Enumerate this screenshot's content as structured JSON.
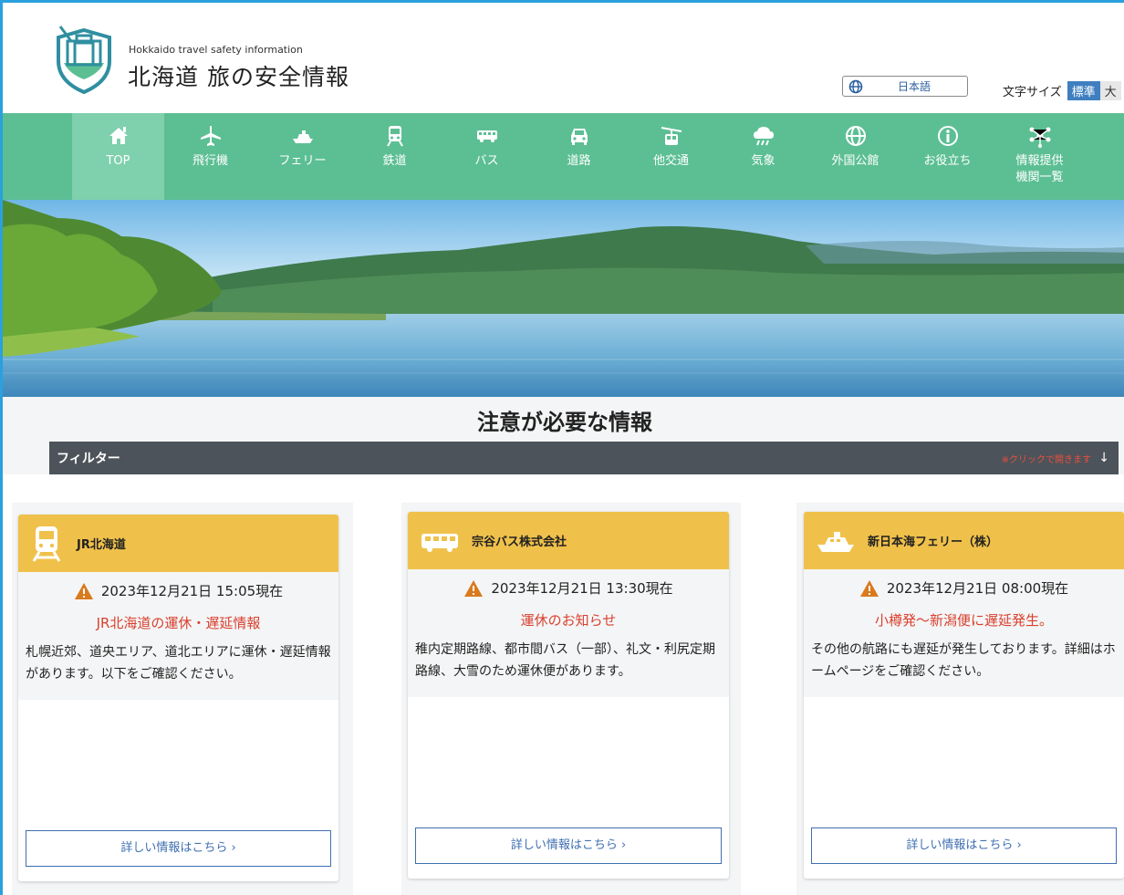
{
  "header": {
    "logo_subtitle": "Hokkaido travel safety information",
    "logo_title": "北海道 旅の安全情報",
    "language": "日本語",
    "font_size_label": "文字サイズ",
    "font_size_standard": "標準",
    "font_size_large": "大"
  },
  "nav": [
    {
      "label": "TOP",
      "icon": "home-icon"
    },
    {
      "label": "飛行機",
      "icon": "airplane-icon"
    },
    {
      "label": "フェリー",
      "icon": "ferry-icon"
    },
    {
      "label": "鉄道",
      "icon": "train-icon"
    },
    {
      "label": "バス",
      "icon": "bus-icon"
    },
    {
      "label": "道路",
      "icon": "car-icon"
    },
    {
      "label": "他交通",
      "icon": "ropeway-icon"
    },
    {
      "label": "気象",
      "icon": "weather-icon"
    },
    {
      "label": "外国公館",
      "icon": "globe-icon"
    },
    {
      "label": "お役立ち",
      "icon": "info-icon"
    },
    {
      "label": "情報提供\n機関一覧",
      "icon": "network-icon"
    }
  ],
  "section": {
    "title": "注意が必要な情報",
    "filter_label": "フィルター",
    "filter_hint": "※クリックで開きます",
    "filter_arrow": "↓"
  },
  "cards": [
    {
      "org": "JR北海道",
      "icon": "train-icon",
      "date": "2023年12月21日 15:05現在",
      "alert": "JR北海道の運休・遅延情報",
      "text": "札幌近郊、道央エリア、道北エリアに運休・遅延情報があります。以下をご確認ください。",
      "button": "詳しい情報はこちら ›"
    },
    {
      "org": "宗谷バス株式会社",
      "icon": "bus-icon",
      "date": "2023年12月21日 13:30現在",
      "alert": "運休のお知らせ",
      "text": "稚内定期路線、都市間バス（一部）、礼文・利尻定期路線、大雪のため運休便があります。",
      "button": "詳しい情報はこちら ›"
    },
    {
      "org": "新日本海フェリー（株）",
      "icon": "ferry-icon",
      "date": "2023年12月21日 08:00現在",
      "alert": "小樽発～新潟便に遅延発生。",
      "text": "その他の航路にも遅延が発生しております。詳細はホームページをご確認ください。",
      "button": "詳しい情報はこちら ›"
    }
  ],
  "colors": {
    "nav_green": "#5cbf93",
    "nav_active": "#7fd0ad",
    "card_header": "#f0c14a",
    "alert_red": "#d9402e",
    "link_blue": "#3f6fb0"
  }
}
